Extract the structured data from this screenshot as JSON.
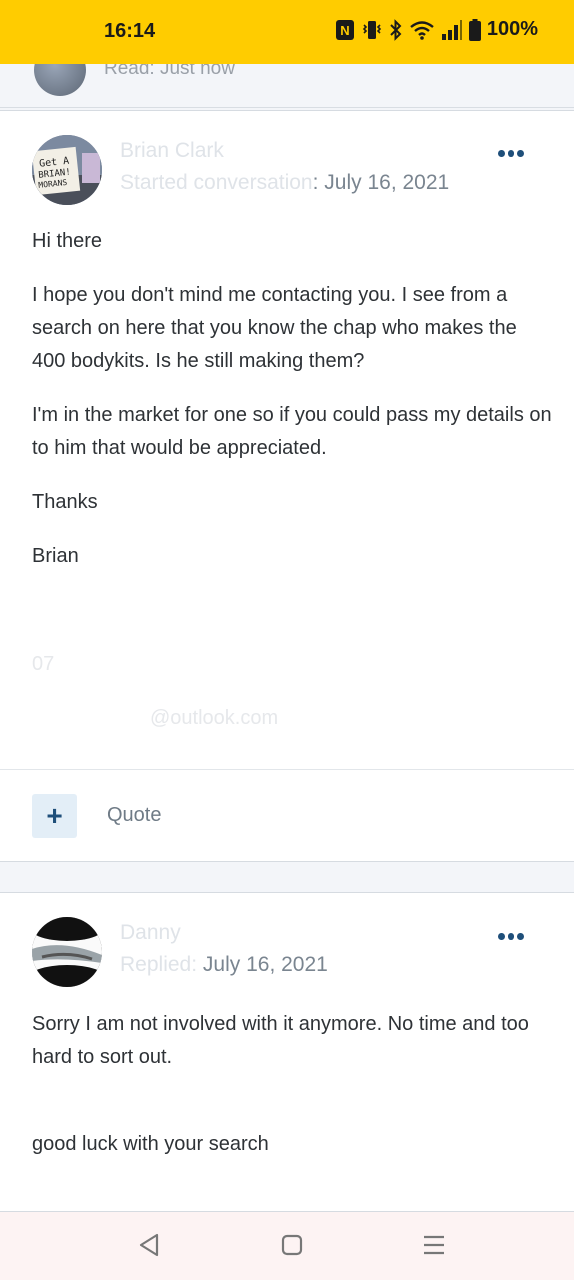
{
  "status": {
    "time": "16:14",
    "battery": "100%"
  },
  "prev": {
    "read_text": "Read: Just now"
  },
  "post1": {
    "author": "Brian Clark",
    "meta_prefix": "Started conversation",
    "meta_date": ": July 16, 2021",
    "paragraphs": [
      "Hi there",
      "I hope you don't mind me contacting you. I see from a search on here that you know the chap who makes the 400 bodykits. Is he still making them?",
      "I'm in the market for one so if you could pass my details on to him that would be appreciated.",
      "Thanks",
      "Brian"
    ],
    "phone": "07",
    "email": "@outlook.com",
    "plus_label": "+",
    "quote_label": "Quote"
  },
  "post2": {
    "author": "Danny",
    "meta_prefix": "Replied:",
    "meta_date": "July 16, 2021",
    "paragraphs": [
      "Sorry I am not involved with it anymore. No time and too hard to sort out.",
      "good luck with your search"
    ]
  },
  "avatar1_text": "Get A BRIAN! MORANS",
  "icons": {
    "more": "more-horizontal-icon",
    "back": "back-triangle-icon",
    "home": "home-square-icon",
    "menu": "menu-lines-icon"
  },
  "colors": {
    "status_bar": "#ffcc00",
    "accent": "#1f4f7a"
  }
}
